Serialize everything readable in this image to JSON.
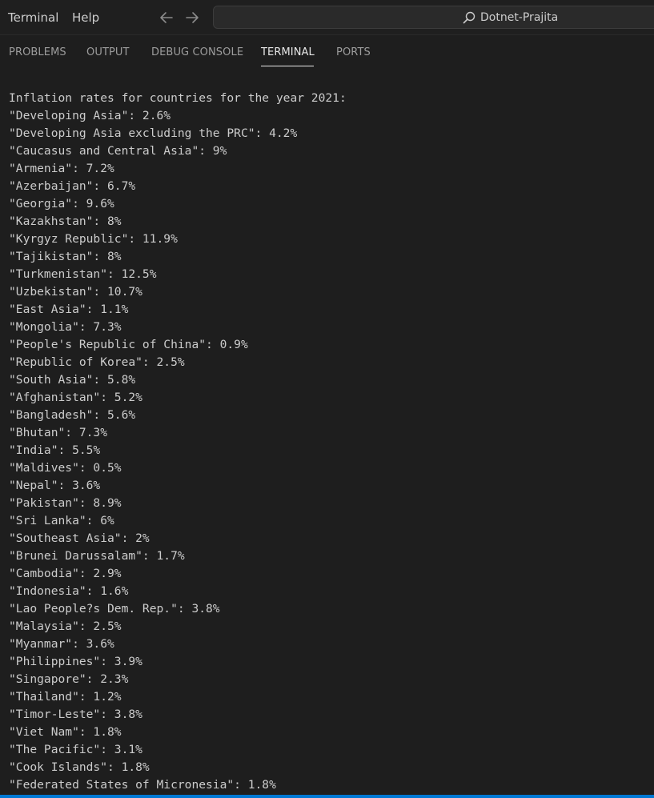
{
  "menu": {
    "items": [
      "Terminal",
      "Help"
    ]
  },
  "navigation": {
    "back_icon": "arrow-left-icon",
    "forward_icon": "arrow-right-icon"
  },
  "command_center": {
    "icon": "search-icon",
    "text": "Dotnet-Prajita"
  },
  "panel": {
    "tabs": [
      {
        "label": "PROBLEMS"
      },
      {
        "label": "OUTPUT"
      },
      {
        "label": "DEBUG CONSOLE"
      },
      {
        "label": "TERMINAL",
        "active": true
      },
      {
        "label": "PORTS"
      }
    ]
  },
  "terminal": {
    "lines": [
      "Inflation rates for countries for the year 2021:",
      "\"Developing Asia\": 2.6%",
      "\"Developing Asia excluding the PRC\": 4.2%",
      "\"Caucasus and Central Asia\": 9%",
      "\"Armenia\": 7.2%",
      "\"Azerbaijan\": 6.7%",
      "\"Georgia\": 9.6%",
      "\"Kazakhstan\": 8%",
      "\"Kyrgyz Republic\": 11.9%",
      "\"Tajikistan\": 8%",
      "\"Turkmenistan\": 12.5%",
      "\"Uzbekistan\": 10.7%",
      "\"East Asia\": 1.1%",
      "\"Mongolia\": 7.3%",
      "\"People's Republic of China\": 0.9%",
      "\"Republic of Korea\": 2.5%",
      "\"South Asia\": 5.8%",
      "\"Afghanistan\": 5.2%",
      "\"Bangladesh\": 5.6%",
      "\"Bhutan\": 7.3%",
      "\"India\": 5.5%",
      "\"Maldives\": 0.5%",
      "\"Nepal\": 3.6%",
      "\"Pakistan\": 8.9%",
      "\"Sri Lanka\": 6%",
      "\"Southeast Asia\": 2%",
      "\"Brunei Darussalam\": 1.7%",
      "\"Cambodia\": 2.9%",
      "\"Indonesia\": 1.6%",
      "\"Lao People?s Dem. Rep.\": 3.8%",
      "\"Malaysia\": 2.5%",
      "\"Myanmar\": 3.6%",
      "\"Philippines\": 3.9%",
      "\"Singapore\": 2.3%",
      "\"Thailand\": 1.2%",
      "\"Timor-Leste\": 3.8%",
      "\"Viet Nam\": 1.8%",
      "\"The Pacific\": 3.1%",
      "\"Cook Islands\": 1.8%",
      "\"Federated States of Micronesia\": 1.8%"
    ]
  },
  "colors": {
    "background": "#1e1e1e",
    "text": "#cccccc",
    "accent": "#0078d4"
  }
}
